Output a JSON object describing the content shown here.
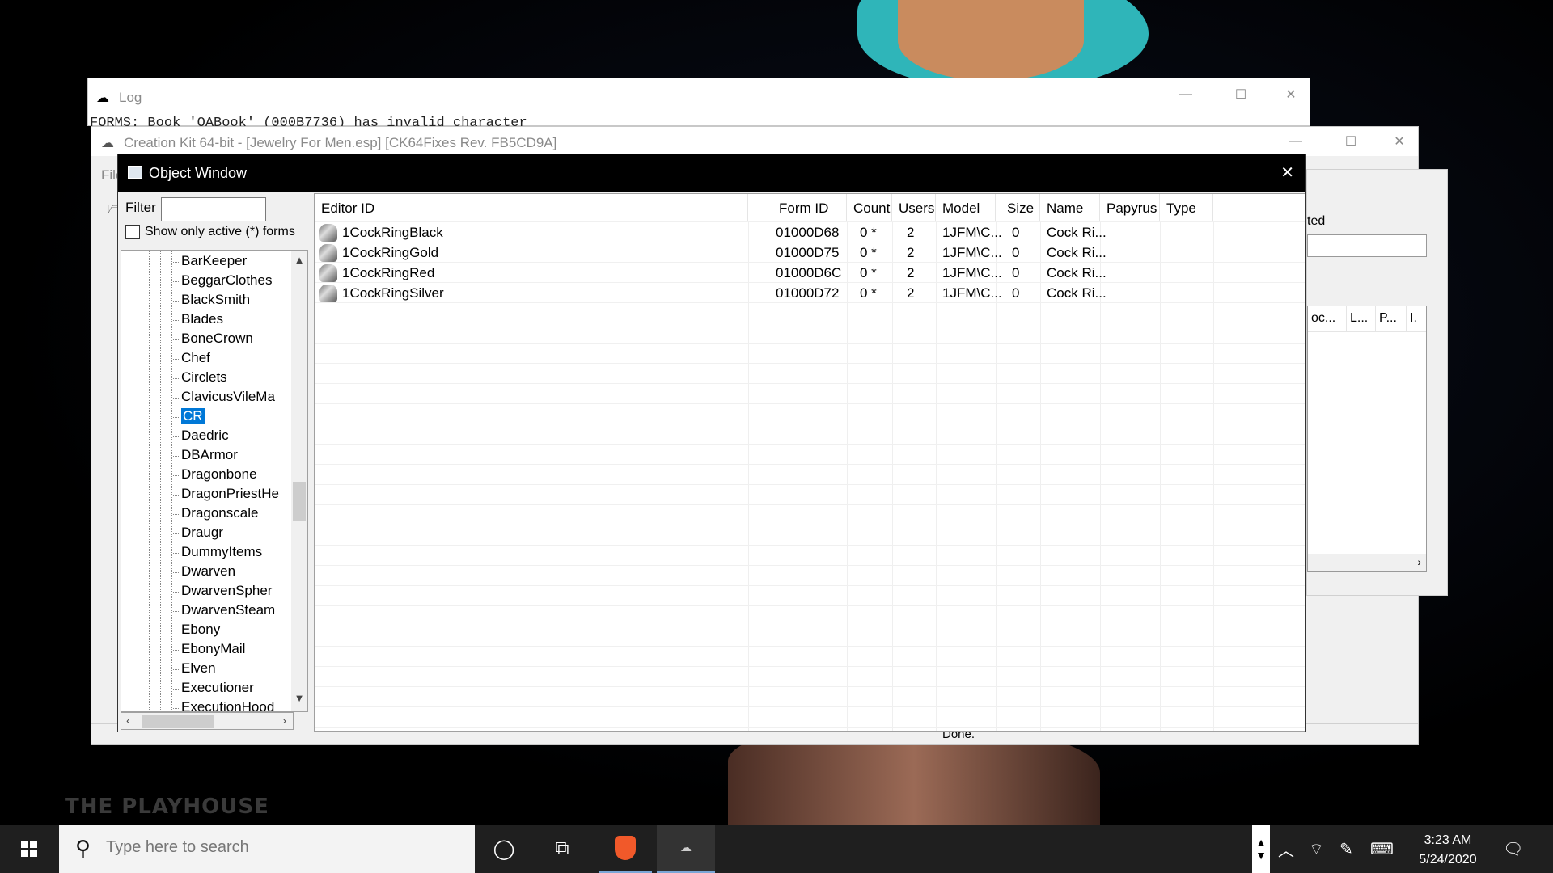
{
  "log_window": {
    "title": "Log",
    "line": "FORMS: Book 'OABook' (000B7736) has invalid character"
  },
  "ck_window": {
    "title": "Creation Kit 64-bit - [Jewelry For Men.esp] [CK64Fixes Rev. FB5CD9A]",
    "menu_first": "File",
    "right_label": "ted",
    "right_cols": [
      "oc...",
      "L...",
      "P...",
      "I."
    ],
    "status": "Done."
  },
  "object_window": {
    "title": "Object Window",
    "filter_label": "Filter",
    "filter_value": "",
    "show_active_label": "Show only active (*) forms",
    "tree": [
      "BarKeeper",
      "BeggarClothes",
      "BlackSmith",
      "Blades",
      "BoneCrown",
      "Chef",
      "Circlets",
      "ClavicusVileMa",
      "CR",
      "Daedric",
      "DBArmor",
      "Dragonbone",
      "DragonPriestHe",
      "Dragonscale",
      "Draugr",
      "DummyItems",
      "Dwarven",
      "DwarvenSpher",
      "DwarvenSteam",
      "Ebony",
      "EbonyMail",
      "Elven",
      "Executioner",
      "ExecutionHood"
    ],
    "selected_tree_item": "CR",
    "columns": [
      "Editor ID",
      "Form ID",
      "Count",
      "Users",
      "Model",
      "Size",
      "Name",
      "Papyrus",
      "Type"
    ],
    "rows": [
      {
        "editor_id": "1CockRingBlack",
        "form_id": "01000D68",
        "count": "0 *",
        "users": "2",
        "model": "1JFM\\C...",
        "size": "0",
        "name": "Cock Ri..."
      },
      {
        "editor_id": "1CockRingGold",
        "form_id": "01000D75",
        "count": "0 *",
        "users": "2",
        "model": "1JFM\\C...",
        "size": "0",
        "name": "Cock Ri..."
      },
      {
        "editor_id": "1CockRingRed",
        "form_id": "01000D6C",
        "count": "0 *",
        "users": "2",
        "model": "1JFM\\C...",
        "size": "0",
        "name": "Cock Ri..."
      },
      {
        "editor_id": "1CockRingSilver",
        "form_id": "01000D72",
        "count": "0 *",
        "users": "2",
        "model": "1JFM\\C...",
        "size": "0",
        "name": "Cock Ri..."
      }
    ]
  },
  "desktop": {
    "watermark": "THE PLAYHOUSE"
  },
  "taskbar": {
    "search_placeholder": "Type here to search",
    "time": "3:23 AM",
    "date": "5/24/2020"
  },
  "icons": {
    "start": "windows-start-icon",
    "search": "magnifier-icon",
    "cortana": "cortana-circle-icon",
    "task_view": "task-view-icon",
    "brave": "brave-browser-icon",
    "creation_kit": "creation-kit-icon",
    "tray_up": "chevron-up-icon",
    "network": "network-icon",
    "pen": "pen-icon",
    "keyboard": "keyboard-icon",
    "notifications": "notification-icon"
  }
}
